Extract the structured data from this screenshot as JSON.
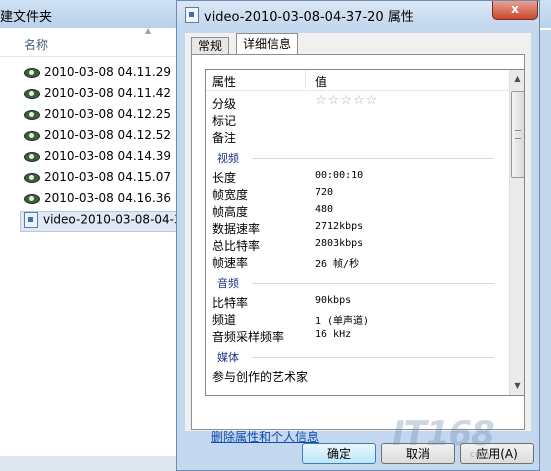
{
  "explorer": {
    "title": "建文件夹",
    "column_name": "名称",
    "files": [
      {
        "name": "2010-03-08 04.11.29",
        "icon": "eye-icon"
      },
      {
        "name": "2010-03-08 04.11.42",
        "icon": "eye-icon"
      },
      {
        "name": "2010-03-08 04.12.25",
        "icon": "eye-icon"
      },
      {
        "name": "2010-03-08 04.12.52",
        "icon": "eye-icon"
      },
      {
        "name": "2010-03-08 04.14.39",
        "icon": "eye-icon"
      },
      {
        "name": "2010-03-08 04.15.07",
        "icon": "eye-icon"
      },
      {
        "name": "2010-03-08 04.16.36",
        "icon": "eye-icon"
      },
      {
        "name": "video-2010-03-08-04-3",
        "icon": "video-file-icon"
      }
    ]
  },
  "dialog": {
    "title": "video-2010-03-08-04-37-20 属性",
    "close_label": "x",
    "tabs": [
      "常规",
      "详细信息"
    ],
    "active_tab": "详细信息",
    "headers": {
      "property": "属性",
      "value": "值"
    },
    "rows_top": [
      {
        "name": "分级",
        "value": ""
      },
      {
        "name": "标记",
        "value": ""
      },
      {
        "name": "备注",
        "value": ""
      }
    ],
    "rating_stars": "☆☆☆☆☆",
    "group_video": "视频",
    "rows_video": [
      {
        "name": "长度",
        "value": "00:00:10"
      },
      {
        "name": "帧宽度",
        "value": "720"
      },
      {
        "name": "帧高度",
        "value": "480"
      },
      {
        "name": "数据速率",
        "value": "2712kbps"
      },
      {
        "name": "总比特率",
        "value": "2803kbps"
      },
      {
        "name": "帧速率",
        "value": "26 帧/秒"
      }
    ],
    "group_audio": "音频",
    "rows_audio": [
      {
        "name": "比特率",
        "value": "90kbps"
      },
      {
        "name": "频道",
        "value": "1 (单声道)"
      },
      {
        "name": "音频采样频率",
        "value": "16 kHz"
      }
    ],
    "group_media": "媒体",
    "rows_media": [
      {
        "name": "参与创作的艺术家",
        "value": ""
      }
    ],
    "remove_link": "删除属性和个人信息",
    "buttons": {
      "ok": "确定",
      "cancel": "取消",
      "apply": "应用(A)"
    }
  },
  "watermark": {
    "logo": "IT168",
    "sub": "com"
  }
}
